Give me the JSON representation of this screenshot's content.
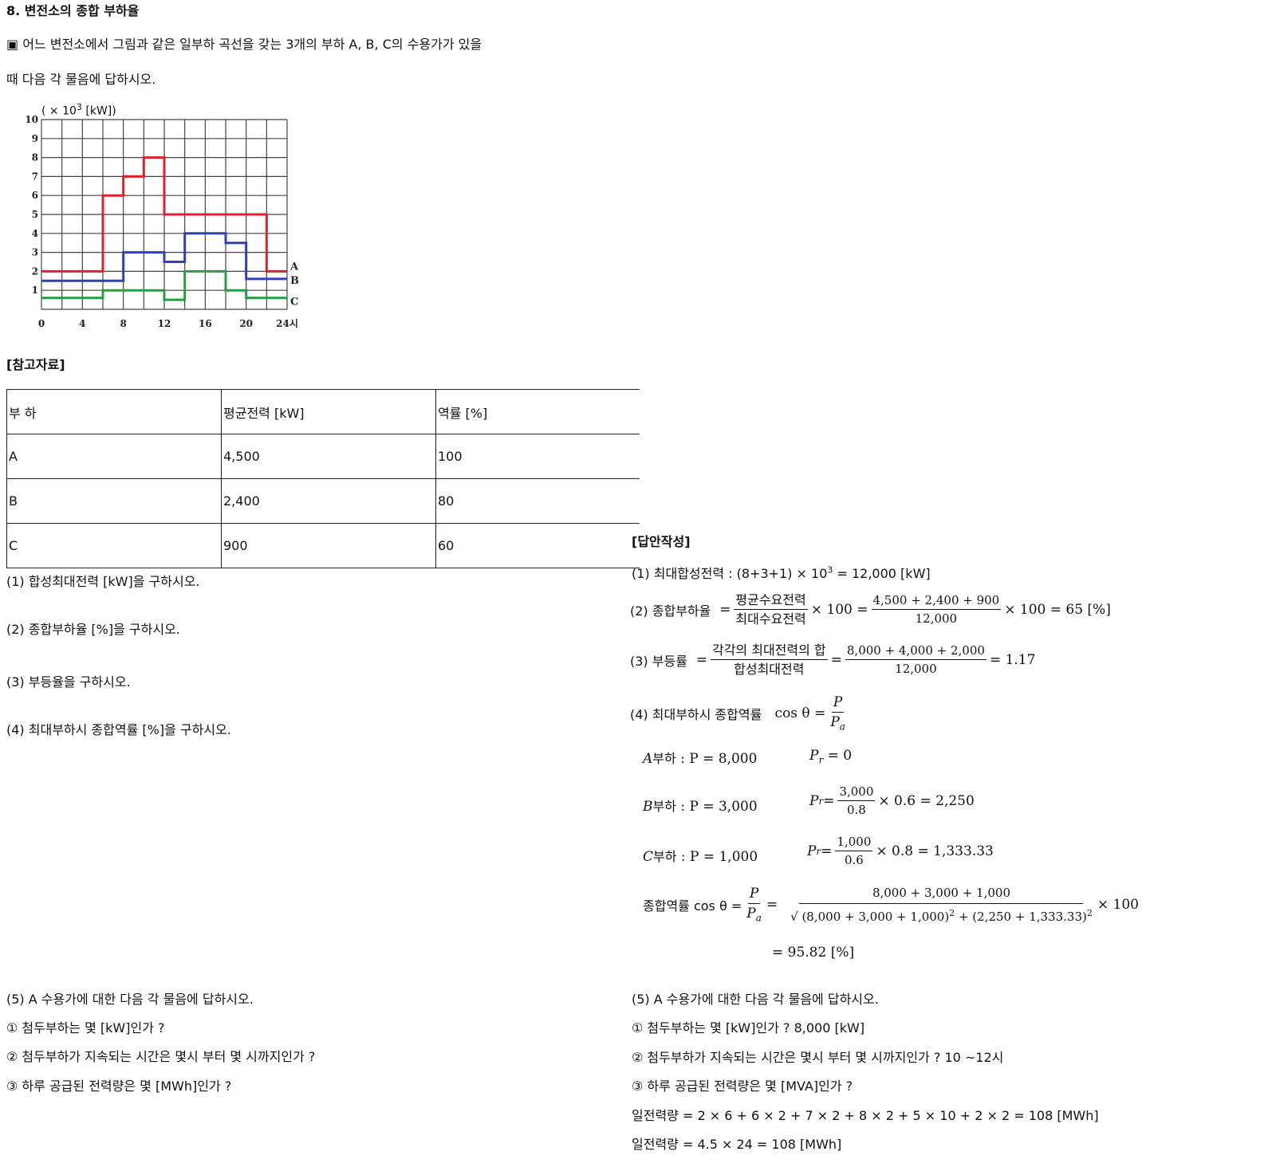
{
  "problem": {
    "title": "8. 변전소의 종합 부하율",
    "intro1": "▣ 어느 변전소에서 그림과 같은 일부하 곡선을 갖는 3개의 부하 A, B, C의 수용가가 있을",
    "intro2": "때 다음 각 물음에 답하시오."
  },
  "chart_data": {
    "type": "line",
    "step": true,
    "unit_label": "( × 10",
    "unit_exp": "3",
    "unit_tail": " [kW])",
    "x_ticks": [
      "0",
      "4",
      "8",
      "12",
      "16",
      "20",
      "24시"
    ],
    "y_ticks": [
      "1",
      "2",
      "3",
      "4",
      "5",
      "6",
      "7",
      "8",
      "9",
      "10"
    ],
    "xlim": [
      0,
      24
    ],
    "ylim": [
      0,
      10
    ],
    "grid": true,
    "series": [
      {
        "name": "A",
        "color": "#e0202a",
        "x": [
          0,
          6,
          8,
          10,
          12,
          22,
          24
        ],
        "y": [
          2,
          6,
          7,
          8,
          5,
          2,
          2
        ]
      },
      {
        "name": "B",
        "color": "#2f3fbf",
        "x": [
          0,
          8,
          12,
          14,
          18,
          20,
          24
        ],
        "y": [
          1.5,
          3,
          2.5,
          4,
          3.5,
          1.6,
          1.6
        ]
      },
      {
        "name": "C",
        "color": "#22a040",
        "x": [
          0,
          6,
          12,
          14,
          18,
          20,
          24
        ],
        "y": [
          0.6,
          1,
          0.5,
          2,
          1,
          0.6,
          0.6
        ]
      }
    ]
  },
  "reference": {
    "heading": "[참고자료]",
    "headers": [
      "부 하",
      "평균전력 [kW]",
      "역률 [%]"
    ],
    "rows": [
      [
        "A",
        "4,500",
        "100"
      ],
      [
        "B",
        "2,400",
        "80"
      ],
      [
        "C",
        "900",
        "60"
      ]
    ]
  },
  "questions": {
    "q1": "(1) 합성최대전력 [kW]을 구하시오.",
    "q2": "(2) 종합부하율 [%]을 구하시오.",
    "q3": "(3) 부등율을 구하시오.",
    "q4": "(4) 최대부하시 종합역률 [%]을 구하시오.",
    "q5": "(5) A 수용가에 대한 다음 각 물음에 답하시오.",
    "q5_1": "① 첨두부하는 몇 [kW]인가 ?",
    "q5_2": "② 첨두부하가 지속되는 시간은 몇시 부터 몇 시까지인가 ?",
    "q5_3": "③ 하루 공급된 전력량은 몇 [MWh]인가 ?"
  },
  "answers": {
    "heading": "[답안작성]",
    "a1_pre": "(1) 최대합성전력 : (8+3+1) × 10",
    "a1_exp": "3",
    "a1_post": " = 12,000 [kW]",
    "a2": {
      "label": "(2) 종합부하율",
      "eq": "=",
      "num1": "평균수요전력",
      "den1": "최대수요전력",
      "mid": "× 100 =",
      "num2": "4,500 + 2,400 + 900",
      "den2": "12,000",
      "end": "× 100 = 65 [%]"
    },
    "a3": {
      "label": "(3) 부등률",
      "eq": "=",
      "num1": "각각의 최대전력의 합",
      "den1": "합성최대전력",
      "mid": "=",
      "num2": "8,000 + 4,000 + 2,000",
      "den2": "12,000",
      "end": "= 1.17"
    },
    "a4": {
      "label": "(4) 최대부하시 종합역률",
      "cos": "cos θ =",
      "num": "P",
      "den_p": "P",
      "den_sub": "a"
    },
    "loadA": {
      "name": "A",
      "name_suffix": "부하",
      "p": " :  P = 8,000",
      "pr": "P",
      "pr_sub": "r",
      "pr_val": " = 0"
    },
    "loadB": {
      "name": "B",
      "name_suffix": "부하",
      "p": " :  P = 3,000",
      "pr": "P",
      "pr_sub": "r",
      "pr_eq": " =",
      "num": "3,000",
      "den": "0.8",
      "tail": "× 0.6 = 2,250"
    },
    "loadC": {
      "name": "C",
      "name_suffix": "부하",
      "p": " : P  =  1,000",
      "pr": "P",
      "pr_sub": "r",
      "pr_eq": " =",
      "num": "1,000",
      "den": "0.6",
      "tail": "× 0.8 = 1,333.33"
    },
    "total": {
      "label": "종합역률 cos θ =",
      "num": "P",
      "den_p": "P",
      "den_sub": "a",
      "eq": "=",
      "num2": "8,000 + 3,000 + 1,000",
      "den2_a": "(8,000 + 3,000 + 1,000)",
      "den2_b": " + (2,250 + 1,333.33)",
      "sq": "2",
      "tail": "× 100",
      "result": "= 95.82 [%]"
    },
    "a5": "(5) A 수용가에 대한 다음 각 물음에 답하시오.",
    "a5_1": "① 첨두부하는 몇 [kW]인가 ? 8,000 [kW]",
    "a5_2": "② 첨두부하가 지속되는 시간은 몇시 부터 몇 시까지인가 ? 10 ~12시",
    "a5_3": "③ 하루 공급된 전력량은 몇 [MVA]인가 ?",
    "a5_4": "일전력량 = 2 × 6 + 6 × 2 + 7 × 2 + 8 × 2 + 5 × 10 + 2 × 2 = 108 [MWh]",
    "a5_5": "일전력량 = 4.5 × 24 = 108 [MWh]"
  }
}
